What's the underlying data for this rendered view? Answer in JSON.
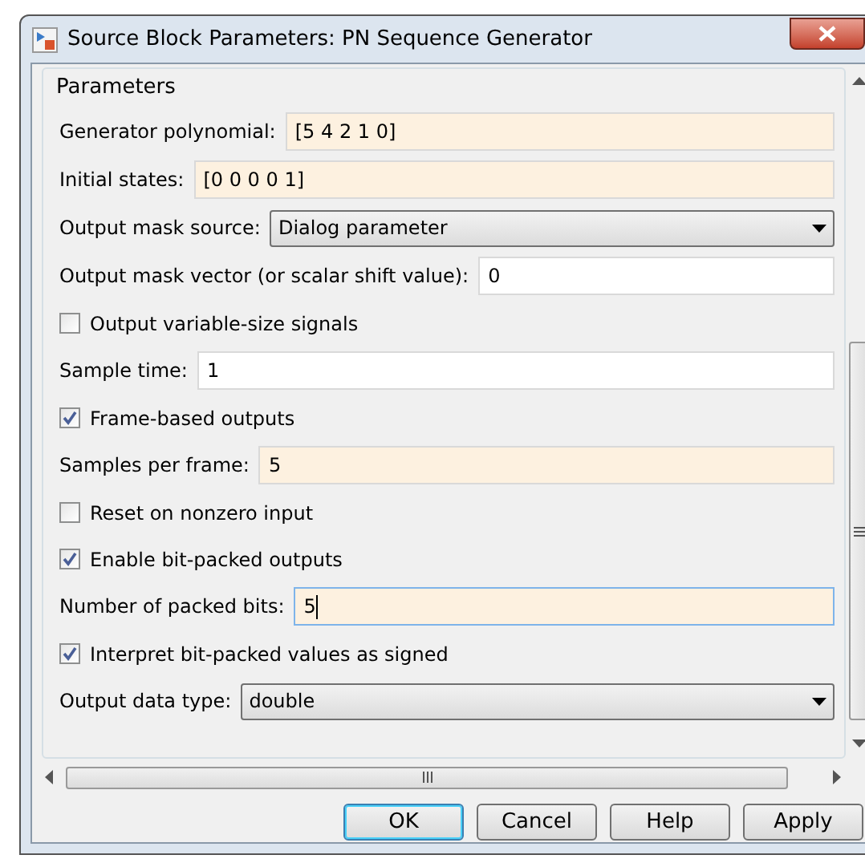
{
  "window": {
    "title": "Source Block Parameters: PN Sequence Generator"
  },
  "group": {
    "title": "Parameters"
  },
  "parameters": [
    {
      "kind": "text",
      "label": "Generator polynomial:",
      "value": "[5 4 2 1 0]",
      "highlighted": true,
      "focused": false
    },
    {
      "kind": "text",
      "label": "Initial states:",
      "value": "[0 0 0 0 1]",
      "highlighted": true,
      "focused": false
    },
    {
      "kind": "dropdown",
      "label": "Output mask source:",
      "value": "Dialog parameter"
    },
    {
      "kind": "text",
      "label": "Output mask vector (or scalar shift value):",
      "value": "0",
      "highlighted": false,
      "focused": false
    },
    {
      "kind": "check",
      "label": "Output variable-size signals",
      "checked": false
    },
    {
      "kind": "text",
      "label": "Sample time:",
      "value": "1",
      "highlighted": false,
      "focused": false
    },
    {
      "kind": "check",
      "label": "Frame-based outputs",
      "checked": true
    },
    {
      "kind": "text",
      "label": "Samples per frame:",
      "value": "5",
      "highlighted": true,
      "focused": false
    },
    {
      "kind": "check",
      "label": "Reset on nonzero input",
      "checked": false
    },
    {
      "kind": "check",
      "label": "Enable bit-packed outputs",
      "checked": true
    },
    {
      "kind": "text",
      "label": "Number of packed bits:",
      "value": "5",
      "highlighted": true,
      "focused": true
    },
    {
      "kind": "check",
      "label": "Interpret bit-packed values as signed",
      "checked": true
    },
    {
      "kind": "dropdown",
      "label": "Output data type:",
      "value": "double"
    }
  ],
  "buttons": [
    {
      "label": "OK",
      "default": true
    },
    {
      "label": "Cancel",
      "default": false
    },
    {
      "label": "Help",
      "default": false
    },
    {
      "label": "Apply",
      "default": false
    }
  ]
}
